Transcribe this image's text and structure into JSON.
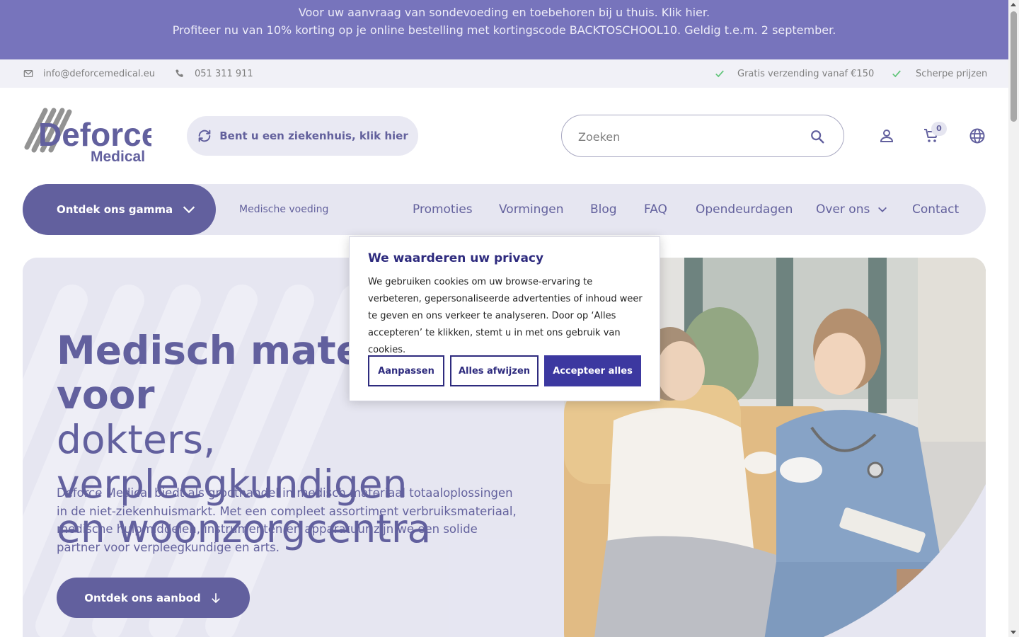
{
  "announcement": {
    "line1": "Voor uw aanvraag van sondevoeding en toebehoren bij u thuis. Klik hier.",
    "line2": "Profiteer nu van 10% korting op je online bestelling met kortingscode BACKTOSCHOOL10. Geldig t.e.m. 2 september."
  },
  "infobar": {
    "email": "info@deforcemedical.eu",
    "phone": "051 311 911",
    "usp1": "Gratis verzending vanaf €150",
    "usp2": "Scherpe prijzen"
  },
  "header": {
    "logo_main": "Deforce",
    "logo_sub": "Medical",
    "hospital_button": "Bent u een ziekenhuis, klik hier",
    "search_placeholder": "Zoeken",
    "cart_count": "0"
  },
  "nav": {
    "main_button": "Ontdek ons gamma",
    "sub_link": "Medische voeding",
    "links": [
      "Promoties",
      "Vormingen",
      "Blog",
      "FAQ",
      "Opendeurdagen",
      "Over ons",
      "Contact"
    ]
  },
  "hero": {
    "title_bold": "Medisch materiaal voor",
    "title_line2": "dokters, verpleegkundigen",
    "title_line3": "en woonzorgcentra",
    "description": "Deforce Medical biedt als groothandel in medisch materiaal totaaloplossingen in de niet-ziekenhuismarkt. Met een compleet assortiment verbruiksmateriaal, medische hulpmiddelen, instrumenten en apparatuur zijn we een solide partner voor verpleegkundige en arts.",
    "cta": "Ontdek ons aanbod"
  },
  "cookie": {
    "title": "We waarderen uw privacy",
    "text": "We gebruiken cookies om uw browse-ervaring te verbeteren, gepersonaliseerde advertenties of inhoud weer te geven en ons verkeer te analyseren. Door op ‘Alles accepteren’ te klikken, stemt u in met ons gebruik van cookies.",
    "customize": "Aanpassen",
    "reject": "Alles afwijzen",
    "accept": "Accepteer alles"
  },
  "colors": {
    "brand": "#2e2b7e",
    "announcement_bg": "#4a46a6",
    "nav_bg": "#dedeed",
    "check_green": "#2bb24c"
  },
  "icons": {
    "email": "mail-icon",
    "phone": "phone-icon",
    "check": "check-icon",
    "sync": "sync-icon",
    "search": "search-icon",
    "account": "user-icon",
    "cart": "cart-icon",
    "language": "globe-icon",
    "chevron": "chevron-down-icon",
    "arrow": "arrow-down-icon"
  }
}
